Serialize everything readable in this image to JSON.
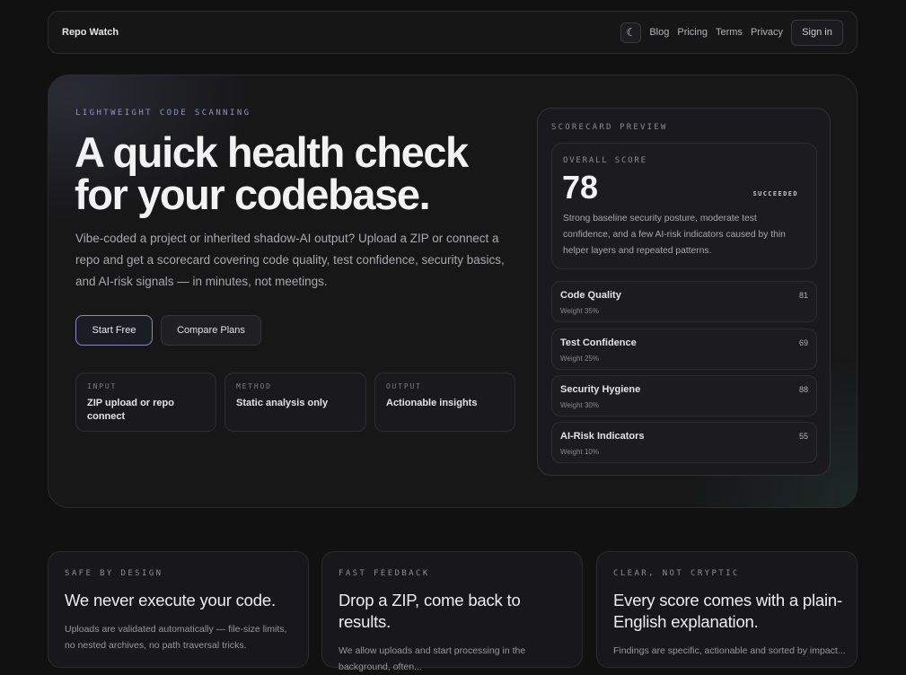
{
  "nav": {
    "brand": "Repo Watch",
    "theme_icon": "moon-icon",
    "links": [
      "Blog",
      "Pricing",
      "Terms",
      "Privacy"
    ],
    "signin_label": "Sign in"
  },
  "hero": {
    "eyebrow": "LIGHTWEIGHT CODE SCANNING",
    "headline": "A quick health check for your codebase.",
    "subtext": "Vibe-coded a project or inherited shadow-AI output? Upload a ZIP or connect a repo and get a scorecard covering code quality, test confidence, security basics, and AI-risk signals — in minutes, not meetings.",
    "primary_cta": "Start Free",
    "secondary_cta": "Compare Plans",
    "info": [
      {
        "label": "INPUT",
        "value": "ZIP upload or repo connect"
      },
      {
        "label": "METHOD",
        "value": "Static analysis only"
      },
      {
        "label": "OUTPUT",
        "value": "Actionable insights"
      }
    ]
  },
  "scorecard": {
    "label": "SCORECARD PREVIEW",
    "overall_label": "OVERALL SCORE",
    "overall_score": "78",
    "status": "SUCCEEDED",
    "description": "Strong baseline security posture, moderate test confidence, and a few AI-risk indicators caused by thin helper layers and repeated patterns.",
    "metrics": [
      {
        "name": "Code Quality",
        "weight": "Weight 35%",
        "value": "81"
      },
      {
        "name": "Test Confidence",
        "weight": "Weight 25%",
        "value": "69"
      },
      {
        "name": "Security Hygiene",
        "weight": "Weight 30%",
        "value": "88"
      },
      {
        "name": "AI-Risk Indicators",
        "weight": "Weight 10%",
        "value": "55"
      }
    ]
  },
  "features": [
    {
      "label": "SAFE BY DESIGN",
      "title": "We never execute your code.",
      "body": "Uploads are validated automatically — file-size limits, no nested archives, no path traversal tricks."
    },
    {
      "label": "FAST FEEDBACK",
      "title": "Drop a ZIP, come back to results.",
      "body": "We allow uploads and start processing in the background, often..."
    },
    {
      "label": "CLEAR, NOT CRYPTIC",
      "title": "Every score comes with a plain-English explanation.",
      "body": "Findings are specific, actionable and sorted by impact..."
    }
  ],
  "colors": {
    "background": "#111112",
    "accent": "#8f95c9",
    "primary_border": "#8a88c8"
  }
}
